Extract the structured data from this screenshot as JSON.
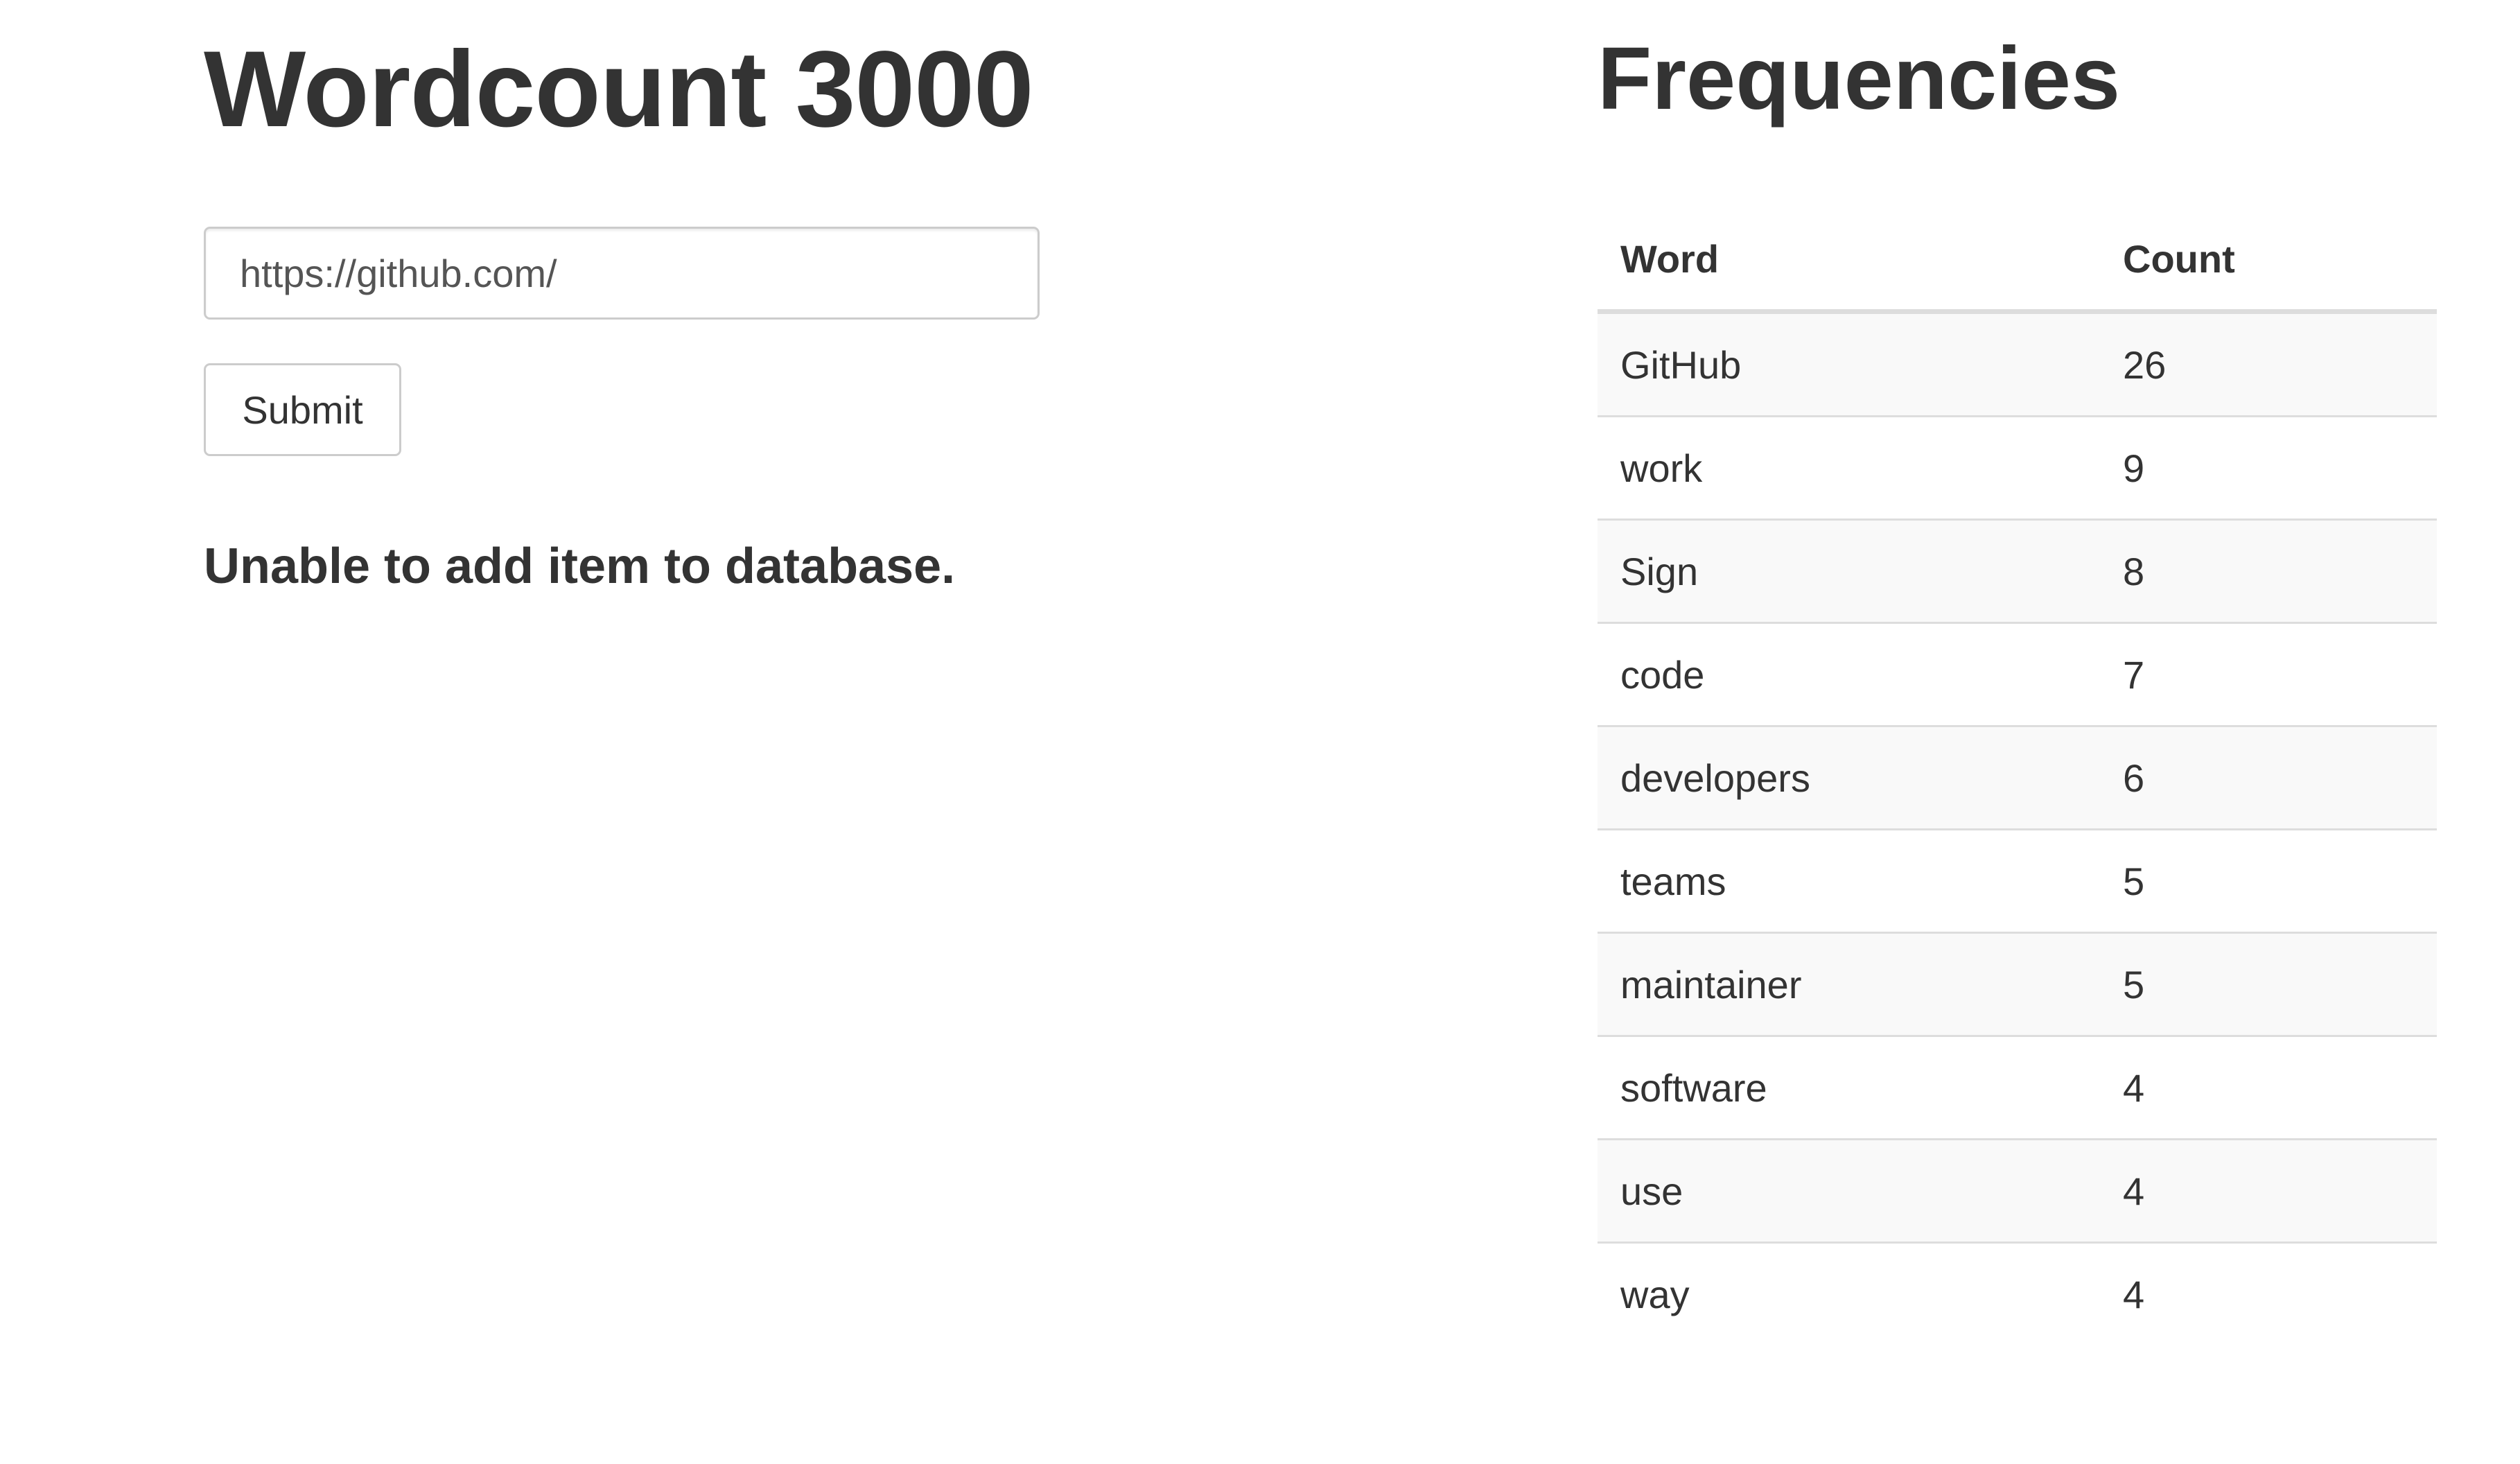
{
  "app": {
    "title": "Wordcount 3000"
  },
  "form": {
    "url_value": "https://github.com/",
    "submit_label": "Submit"
  },
  "status": {
    "message": "Unable to add item to database."
  },
  "frequencies": {
    "title": "Frequencies",
    "columns": [
      "Word",
      "Count"
    ],
    "rows": [
      {
        "word": "GitHub",
        "count": "26"
      },
      {
        "word": "work",
        "count": "9"
      },
      {
        "word": "Sign",
        "count": "8"
      },
      {
        "word": "code",
        "count": "7"
      },
      {
        "word": "developers",
        "count": "6"
      },
      {
        "word": "teams",
        "count": "5"
      },
      {
        "word": "maintainer",
        "count": "5"
      },
      {
        "word": "software",
        "count": "4"
      },
      {
        "word": "use",
        "count": "4"
      },
      {
        "word": "way",
        "count": "4"
      }
    ]
  }
}
